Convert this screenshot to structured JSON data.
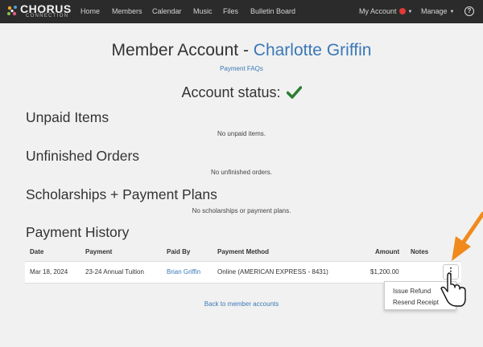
{
  "nav": {
    "logo_word": "CHORUS",
    "logo_sub": "CONNECTION",
    "links": [
      "Home",
      "Members",
      "Calendar",
      "Music",
      "Files",
      "Bulletin Board"
    ],
    "my_account": "My Account",
    "manage": "Manage",
    "help": "?"
  },
  "page": {
    "title_prefix": "Member Account - ",
    "member_name": "Charlotte Griffin",
    "faq_link": "Payment FAQs",
    "status_label": "Account status:"
  },
  "sections": {
    "unpaid": {
      "heading": "Unpaid Items",
      "empty": "No unpaid items."
    },
    "unfinished": {
      "heading": "Unfinished Orders",
      "empty": "No unfinished orders."
    },
    "scholarships": {
      "heading": "Scholarships + Payment Plans",
      "empty": "No scholarships or payment plans."
    },
    "history": {
      "heading": "Payment History"
    }
  },
  "history_table": {
    "headers": {
      "date": "Date",
      "payment": "Payment",
      "paid_by": "Paid By",
      "method": "Payment Method",
      "amount": "Amount",
      "notes": "Notes"
    },
    "rows": [
      {
        "date": "Mar 18, 2024",
        "payment": "23-24 Annual Tuition",
        "paid_by": "Brian Griffin",
        "method": "Online (AMERICAN EXPRESS - 8431)",
        "amount": "$1,200.00",
        "notes": ""
      }
    ]
  },
  "row_menu": {
    "button": "⋮",
    "items": [
      "Issue Refund",
      "Resend Receipt"
    ]
  },
  "back_link": "Back to member accounts",
  "colors": {
    "navbar": "#2b2b2b",
    "link": "#3a78b6",
    "status_ok": "#2e7d32",
    "alert": "#e53935",
    "arrow": "#f08a1c"
  },
  "icons": {
    "status": "checkmark-icon",
    "pointer": "hand-pointer-icon",
    "annotation": "orange-arrow-icon"
  }
}
